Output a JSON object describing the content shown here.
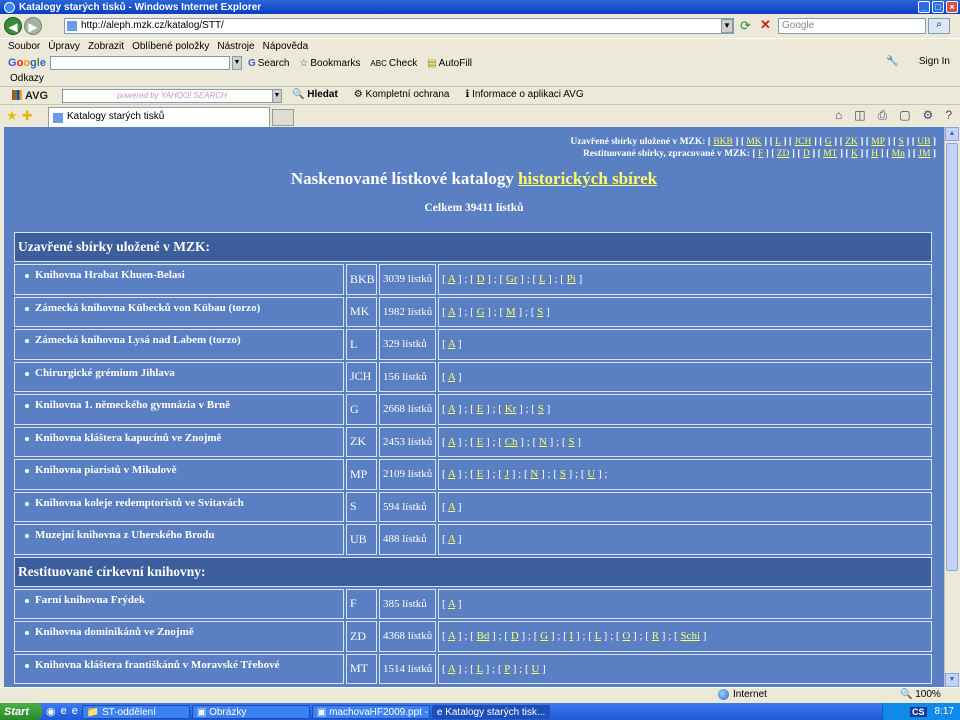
{
  "window": {
    "title": "Katalogy starých tisků - Windows Internet Explorer"
  },
  "address": {
    "url": "http://aleph.mzk.cz/katalog/STT/",
    "search_placeholder": "Google"
  },
  "menu": [
    "Soubor",
    "Úpravy",
    "Zobrazit",
    "Oblíbené položky",
    "Nástroje",
    "Nápověda"
  ],
  "google_bar": {
    "logo": "Google",
    "items": [
      "Search",
      "Bookmarks",
      "Check",
      "AutoFill"
    ],
    "sign_in": "Sign In"
  },
  "links_label": "Odkazy",
  "avg_bar": {
    "logo": "AVG",
    "search_hint": "powered by YAHOO! SEARCH",
    "items": [
      "Hledat",
      "Kompletní ochrana",
      "Informace o aplikaci AVG"
    ]
  },
  "tab": {
    "title": "Katalogy starých tisků"
  },
  "page": {
    "top_line1_label": "Uzavřené sbírky uložené v MZK:",
    "top_line1_codes": [
      "BKB",
      "MK",
      "L",
      "JCH",
      "G",
      "ZK",
      "MP",
      "S",
      "UB"
    ],
    "top_line2_label": "Restituované sbírky, zpracované v MZK:",
    "top_line2_codes": [
      "F",
      "ZD",
      "D",
      "MT",
      "K",
      "H",
      "Mn",
      "JM"
    ],
    "title_prefix": "Naskenované lístkové katalogy",
    "title_link": "historických sbírek",
    "total": "Celkem 39411 lístků"
  },
  "sections": [
    {
      "heading": "Uzavřené sbírky uložené v MZK:",
      "rows": [
        {
          "name": "Knihovna Hrabat Khuen-Belasi",
          "code": "BKB",
          "count": "3039 lístků",
          "letters": [
            "A",
            "D",
            "Gr",
            "L",
            "Pi"
          ]
        },
        {
          "name": "Zámecká knihovna Kübecků von Kübau (torzo)",
          "code": "MK",
          "count": "1982 lístků",
          "letters": [
            "A",
            "G",
            "M",
            "S"
          ]
        },
        {
          "name": "Zámecká knihovna Lysá nad Labem (torzo)",
          "code": "L",
          "count": "329 lístků",
          "letters": [
            "A"
          ]
        },
        {
          "name": "Chirurgické grémium Jihlava",
          "code": "JCH",
          "count": "156 lístků",
          "letters": [
            "A"
          ]
        },
        {
          "name": "Knihovna 1. německého gymnázia v Brně",
          "code": "G",
          "count": "2668 lístků",
          "letters": [
            "A",
            "E",
            "Kr",
            "S"
          ]
        },
        {
          "name": "Knihovna kláštera kapucínů ve Znojmě",
          "code": "ZK",
          "count": "2453 lístků",
          "letters": [
            "A",
            "E",
            "Ch",
            "N",
            "S"
          ]
        },
        {
          "name": "Knihovna piaristů v Mikulově",
          "code": "MP",
          "count": "2109 lístků",
          "letters": [
            "A",
            "E",
            "J",
            "N",
            "S",
            "U"
          ],
          "trailing": " ;"
        },
        {
          "name": "Knihovna koleje redemptoristů ve Svitavách",
          "code": "S",
          "count": "594 lístků",
          "letters": [
            "A"
          ]
        },
        {
          "name": "Muzejní knihovna z Uherského Brodu",
          "code": "UB",
          "count": "488 lístků",
          "letters": [
            "A"
          ]
        }
      ]
    },
    {
      "heading": "Restituované církevní knihovny:",
      "rows": [
        {
          "name": "Farní knihovna Frýdek",
          "code": "F",
          "count": "385 lístků",
          "letters": [
            "A"
          ]
        },
        {
          "name": "Knihovna dominikánů ve Znojmě",
          "code": "ZD",
          "count": "4368 lístků",
          "letters": [
            "A",
            "Bd",
            "D",
            "G",
            "I",
            "L",
            "O",
            "R",
            "Schi"
          ]
        },
        {
          "name": "Knihovna kláštera františkánů v Moravské Třebové",
          "code": "MT",
          "count": "1514 lístků",
          "letters": [
            "A",
            "L",
            "P",
            "U"
          ]
        }
      ]
    }
  ],
  "status": {
    "zone": "Internet",
    "zoom": "100%"
  },
  "taskbar": {
    "start": "Start",
    "buttons": [
      "ST-oddělení",
      "Obrázky",
      "machovaHF2009.ppt - Op...",
      "Katalogy starých tisk..."
    ],
    "lang": "CS",
    "clock": "8:17"
  }
}
